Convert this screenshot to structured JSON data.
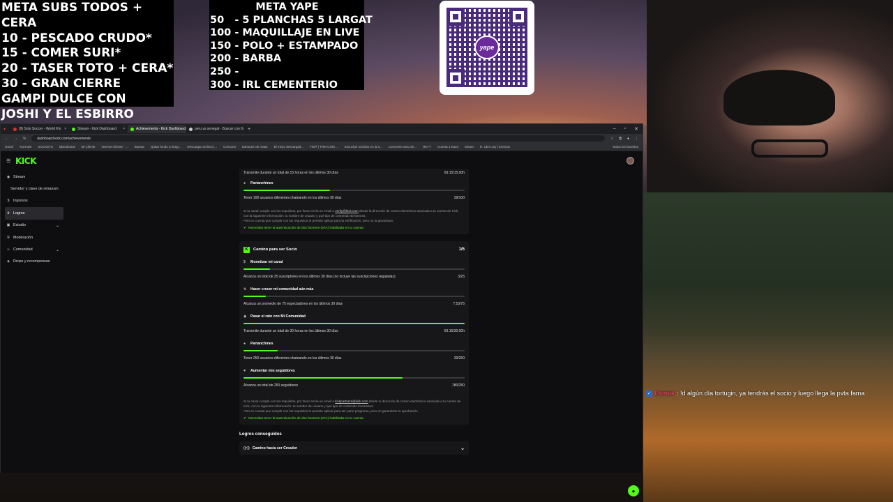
{
  "overlay": {
    "goals_left": [
      "META SUBS TODOS + CERA",
      "10 - PESCADO CRUDO*",
      "15 - COMER SURI*",
      "20 - TASER TOTO + CERA*",
      "30 - GRAN CIERRE",
      "GAMPI DULCE CON",
      "JOSHI Y EL ESBIRRO"
    ],
    "yape_title": "META YAPE",
    "yape_goals": [
      "50   - 5 PLANCHAS 5 LARGAT",
      "100 - MAQUILLAJE EN LIVE",
      "150 - POLO + ESTAMPADO",
      "200 - BARBA",
      "250 -",
      "300 - IRL CEMENTERIO"
    ],
    "qr_logo": "yape"
  },
  "chat": {
    "user": "Esmak",
    "message": ": !d algún día tortugin, ya tendrás el socio y luego llega la pvta fama"
  },
  "browser": {
    "tabs": [
      {
        "label": "(9) Solo Soccer - World Kin",
        "color": "#e03030",
        "active": false
      },
      {
        "label": "Stream - Kick Dashboard",
        "color": "#53fc18",
        "active": false
      },
      {
        "label": "Achievements - Kick Dashboard",
        "color": "#53fc18",
        "active": true
      },
      {
        "label": "peru vs senegal - Buscar con G",
        "color": "#cccccc",
        "active": false
      }
    ],
    "new_tab": "+",
    "url": "dashboard.kick.com/achievements",
    "bookmarks": [
      "Gmail",
      "YouTube",
      "SOCKETS",
      "Blackboard",
      "Mi Cliente",
      "Internet Cliente - ...",
      "Baesar",
      "Quitar fondo a imag...",
      "Descargar archivo |...",
      "Consorio",
      "Extractor de notas",
      "El mejor descargad...",
      "Filo® | TRM COM ...",
      "Escuchar sonidos en la a...",
      "Conventir texto de...",
      "RKTY",
      "Cuenta 1 Kaza",
      "Steam",
      "R. Cbrs Joy | Eventos",
      "Todos los favoritos"
    ]
  },
  "app": {
    "logo": "KICK",
    "sidebar": [
      {
        "label": "Stream",
        "icon": "broadcast-icon"
      },
      {
        "label": "Servidor y clave de retransm",
        "icon": ""
      },
      {
        "label": "Ingresos",
        "icon": "money-icon"
      },
      {
        "label": "Logros",
        "icon": "trophy-icon",
        "active": true
      },
      {
        "label": "Estudio",
        "icon": "studio-icon",
        "expand": true
      },
      {
        "label": "Moderación",
        "icon": "shield-icon"
      },
      {
        "label": "Comunidad",
        "icon": "community-icon",
        "expand": true
      },
      {
        "label": "Drops y recompensas",
        "icon": "gift-icon"
      }
    ],
    "affiliate": {
      "stream_desc": "Transmite durante un total de 15 horas en los últimos 30 días",
      "stream_value": "69.15/15.00h",
      "chat_title": "Partanchines",
      "chat_desc": "Tener 100 usuarios diferentes chateando en los últimos 30 días",
      "chat_value": "39/100",
      "chat_progress": 0.39,
      "note1_a": "Si tu canal cumple con los requisitos, por favor envía un email a ",
      "note1_email": "verify@kick.com",
      "note1_b": " desde la dirección de correo electrónico asociada a tu cuenta de Kick, con la siguiente información: tu nombre de usuario y qué tipo de contenido streameas.",
      "note2": "•Ten en cuenta que cumplir con los requisitos te permite aplicar para la verificación, pero no la garantizan.",
      "twofa": "Necesitas tener la autenticación de dos factores (2FA) habilitada en tu cuenta"
    },
    "partner": {
      "title": "Camino para ser Socio",
      "count": "1/5",
      "tasks": [
        {
          "title": "Monetizar mi canal",
          "icon": "dollar-icon",
          "desc": "Alcanza un total de 25 suscriptores en los últimos 30 días (no incluye las suscripciones regaladas)",
          "value": "3/25",
          "progress": 0.12
        },
        {
          "title": "Hacer crecer mi comunidad aún más",
          "icon": "growth-icon",
          "desc": "Alcanza un promedio de 75 espectadores en los últimos 30 días",
          "value": "7.53/75",
          "progress": 0.1
        },
        {
          "title": "Pasar el rato con Mi Comunidad",
          "icon": "broadcast-icon",
          "desc": "Transmite durante un total de 30 horas en los últimos 30 días",
          "value": "69.15/30.00h",
          "progress": 1.0
        },
        {
          "title": "Partanchines",
          "icon": "chat-icon",
          "desc": "Tener 250 usuarios diferentes chateando en los últimos 30 días",
          "value": "39/250",
          "progress": 0.156
        },
        {
          "title": "Aumentar mis seguidores",
          "icon": "heart-icon",
          "desc": "Alcanza un total de 250 seguidores",
          "value": "180/250",
          "progress": 0.72
        }
      ],
      "note1_a": "Si tu canal cumple con los requisitos, por favor envía un email a ",
      "note1_email": "kickpartners@kick.com",
      "note1_b": " desde tu dirección de correo electrónico asociada a tu cuenta de Kick, con la siguiente información: tu nombre de usuario y qué tipo de contenido transmites.",
      "note2": "•Ten en cuenta que cumplir con los requisitos te permite aplicar para ser parte programa, pero no garantizan tu aprobación.",
      "twofa": "Necesitas tener la autenticación de dos factores (2FA) habilitada en tu cuenta"
    },
    "achievements_title": "Logros conseguidos",
    "creator_row": "Camino hacia ser Creador"
  },
  "colors": {
    "accent": "#53fc18",
    "bg": "#0e0e10",
    "card": "#17171a"
  }
}
